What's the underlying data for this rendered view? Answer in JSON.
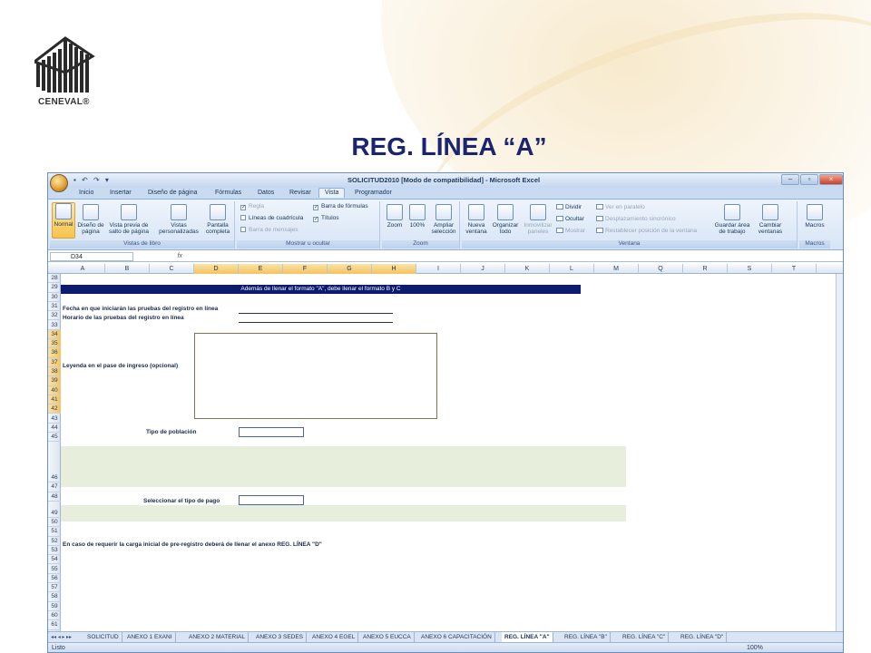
{
  "logo": {
    "text": "CENEVAL®"
  },
  "slide_title": "REG. LÍNEA “A”",
  "excel": {
    "window_title": "SOLICITUD2010  [Modo de compatibilidad] - Microsoft Excel",
    "tabs": [
      "Inicio",
      "Insertar",
      "Diseño de página",
      "Fórmulas",
      "Datos",
      "Revisar",
      "Vista",
      "Programador"
    ],
    "active_tab": "Vista",
    "ribbon": {
      "vistas_libro": {
        "name": "Vistas de libro",
        "buttons": [
          "Normal",
          "Diseño de página",
          "Vista previa de salto de página",
          "Vistas personalizadas",
          "Pantalla completa"
        ]
      },
      "mostrar": {
        "name": "Mostrar u ocultar",
        "items": [
          "Regla",
          "Líneas de cuadrícula",
          "Barra de mensajes",
          "Barra de fórmulas",
          "Títulos"
        ]
      },
      "zoom": {
        "name": "Zoom",
        "buttons": [
          "Zoom",
          "100%",
          "Ampliar selección"
        ]
      },
      "ventana": {
        "name": "Ventana",
        "buttons": [
          "Nueva ventana",
          "Organizar todo",
          "Inmovilizar paneles"
        ],
        "small": [
          "Dividir",
          "Ocultar",
          "Mostrar",
          "Ver en paralelo",
          "Desplazamiento sincrónico",
          "Restablecer posición de la ventana"
        ],
        "more": [
          "Guardar área de trabajo",
          "Cambiar ventanas"
        ]
      },
      "macros": {
        "name": "Macros",
        "buttons": [
          "Macros"
        ]
      }
    },
    "name_box": "D34",
    "fx": "fx",
    "columns": [
      "A",
      "B",
      "C",
      "D",
      "E",
      "F",
      "G",
      "H",
      "I",
      "J",
      "K",
      "L",
      "M",
      "Q",
      "R",
      "S",
      "T"
    ],
    "highlighted_columns": [
      "D",
      "E",
      "F",
      "G",
      "H"
    ],
    "rows": [
      "28",
      "29",
      "30",
      "31",
      "32",
      "33",
      "34",
      "35",
      "36",
      "37",
      "38",
      "39",
      "40",
      "41",
      "42",
      "43",
      "44",
      "45",
      "46",
      "47",
      "48",
      "49",
      "50",
      "51",
      "52",
      "53",
      "54",
      "55",
      "56",
      "57",
      "58",
      "59",
      "60",
      "61"
    ],
    "banner": "Además de llenar el formato \"A\", debe llenar el formato B y C",
    "labels": {
      "fecha": "Fecha en que iniciarán las pruebas del registro en línea",
      "horario": "Horario de las pruebas del registro en línea",
      "leyenda": "Leyenda en el pase de ingreso (opcional)",
      "tipo_poblacion": "Tipo de población",
      "tipo_pago": "Seleccionar el tipo de pago",
      "anexo_d": "En caso de requerir la carga inicial de pre-registro deberá de llenar el anexo REG. LÍNEA \"D\""
    },
    "sheet_tabs": [
      "SOLICITUD",
      "ANEXO 1 EXANI",
      "ANEXO 2 MATERIAL",
      "ANEXO 3 SEDES",
      "ANEXO 4 EGEL",
      "ANEXO 5 EUCCA",
      "ANEXO 6 CAPACITACIÓN",
      "REG. LÍNEA \"A\"",
      "REG. LÍNEA \"B\"",
      "REG. LÍNEA \"C\"",
      "REG. LÍNEA \"D\""
    ],
    "active_sheet": "REG. LÍNEA \"A\"",
    "status": "Listo",
    "zoom_level": "100%"
  }
}
